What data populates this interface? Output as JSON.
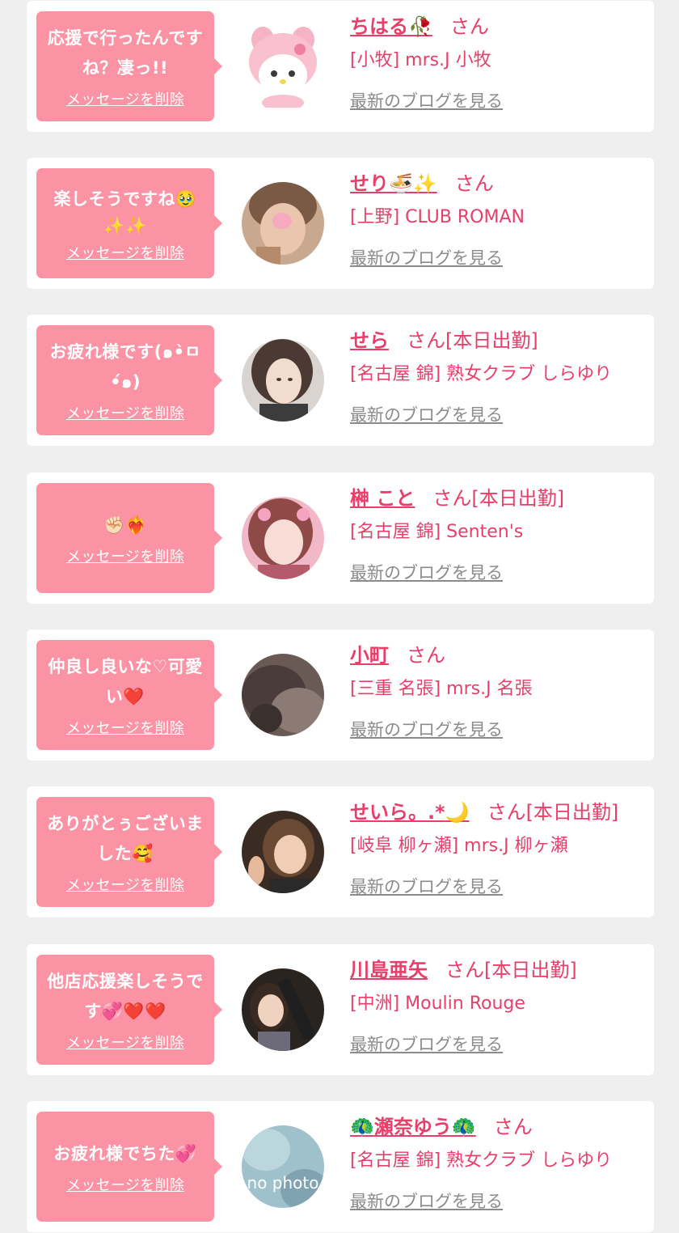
{
  "common": {
    "delete_label": "メッセージを削除",
    "blog_label": "最新のブログを見る",
    "san_label": "さん"
  },
  "cards": [
    {
      "message": "応援で行ったんですね？凄っ!!",
      "name": "ちはる",
      "name_emoji": "🥀",
      "status": "",
      "shop": "[小牧] mrs.J 小牧",
      "avatar_desc": "my-melody-plush"
    },
    {
      "message": "楽しそうですね🥹",
      "message2": "✨✨",
      "name": "せり",
      "name_emoji": "🍜✨",
      "status": "",
      "shop": "[上野] CLUB ROMAN",
      "avatar_desc": "blurred-face-photo"
    },
    {
      "message": "お疲れ様です(๑•̀ㅁ•́๑)",
      "name": "せら",
      "name_emoji": "",
      "status": "[本日出勤]",
      "shop": "[名古屋 錦] 熟女クラブ しらゆり",
      "avatar_desc": "selfie-photo"
    },
    {
      "message": "✊🏻❤️‍🔥",
      "name": "榊 こと",
      "name_emoji": "",
      "status": "[本日出勤]",
      "shop": "[名古屋 錦] Senten's",
      "avatar_desc": "pink-filter-selfie"
    },
    {
      "message": "仲良し良いな♡可愛い❤️",
      "name": "小町",
      "name_emoji": "",
      "status": "",
      "shop": "[三重 名張] mrs.J 名張",
      "avatar_desc": "dark-blurred-photo"
    },
    {
      "message": "ありがとぅございました🥰",
      "name": "せいら。.*",
      "name_emoji": "🌙",
      "status": "[本日出勤]",
      "shop": "[岐阜 柳ヶ瀬] mrs.J 柳ヶ瀬",
      "avatar_desc": "peace-sign-selfie"
    },
    {
      "message": "他店応援楽しそうです💞❤️❤️",
      "name": "川島亜矢",
      "name_emoji": "",
      "status": "[本日出勤]",
      "shop": "[中洲] Moulin Rouge",
      "avatar_desc": "champagne-photo"
    },
    {
      "message": "お疲れ様でちた💞",
      "name": "瀬奈ゆう",
      "name_emoji_pre": "🦚",
      "name_emoji": "🦚",
      "status": "",
      "shop": "[名古屋 錦] 熟女クラブ しらゆり",
      "avatar_desc": "no-photo-placeholder",
      "avatar_text": "no photo"
    }
  ],
  "colors": {
    "bubble": "#fb93a4",
    "accent": "#e83e6a",
    "link_gray": "#8b8b8b",
    "background": "#efefef"
  }
}
